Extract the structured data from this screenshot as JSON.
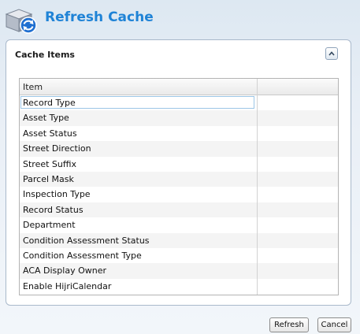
{
  "window": {
    "title": "Refresh Cache",
    "icon": "refresh-cache-icon"
  },
  "panel": {
    "title": "Cache Items",
    "collapse_icon": "chevron-up-icon"
  },
  "grid": {
    "columns": [
      "Item",
      ""
    ],
    "rows": [
      "Record Type",
      "Asset Type",
      "Asset Status",
      "Street Direction",
      "Street Suffix",
      "Parcel Mask",
      "Inspection Type",
      "Record Status",
      "Department",
      "Condition Assessment Status",
      "Condition Assessment Type",
      "ACA Display Owner",
      "Enable HijriCalendar"
    ],
    "selected_row": 0
  },
  "buttons": {
    "refresh": "Refresh",
    "cancel": "Cancel"
  },
  "colors": {
    "title": "#1f83d6",
    "selection_border": "#9cc6e6",
    "panel_border": "#a9b9cb"
  }
}
